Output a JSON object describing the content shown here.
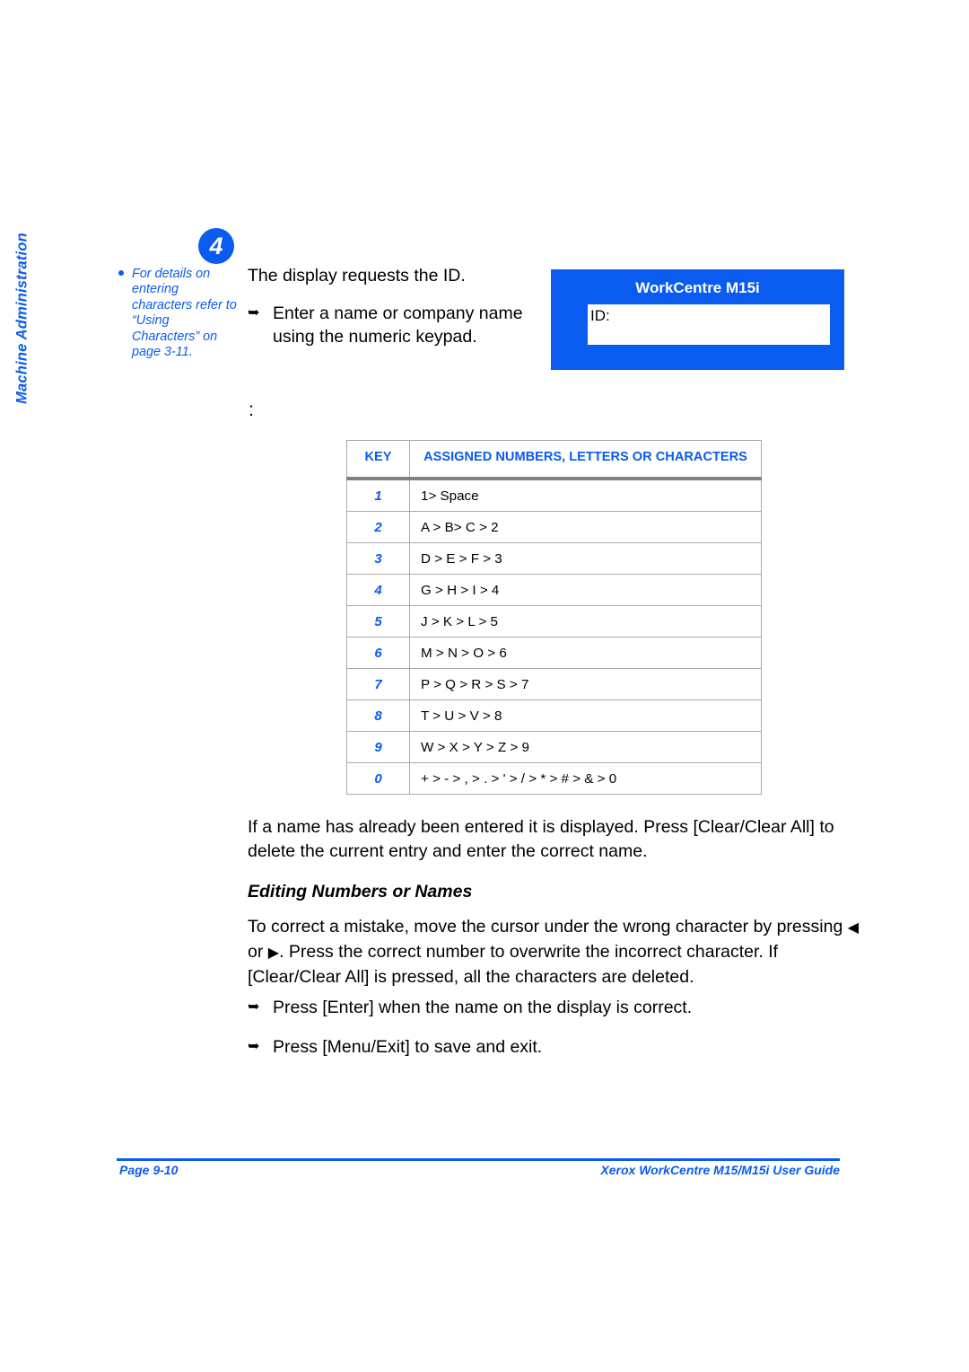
{
  "chapter_tab": {
    "label": "Machine Administration"
  },
  "margin_note": {
    "bullet_icon": "bullet-dot-icon",
    "text": "For details on entering characters refer to “Using Characters” on page 3-11."
  },
  "step": {
    "number": "4",
    "lead": "The display requests the ID.",
    "arrow_icon": "arrow-bullet-icon",
    "items": [
      "Enter a name or company name using the numeric keypad."
    ]
  },
  "colon_artifact": ":",
  "lcd_panel": {
    "title": "WorkCentre M15i",
    "screen_text": "ID:",
    "panel_color": "#0A5BEF",
    "screen_color": "#FFFFFF",
    "title_color": "#FFFFFF"
  },
  "key_table": {
    "headers": [
      "KEY",
      "ASSIGNED NUMBERS, LETTERS OR CHARACTERS"
    ],
    "header_color": "#0A5BEF",
    "key_color": "#0A5BEF",
    "rows": [
      {
        "key": "1",
        "chars": "1> Space"
      },
      {
        "key": "2",
        "chars": "A > B> C > 2"
      },
      {
        "key": "3",
        "chars": "D > E > F > 3"
      },
      {
        "key": "4",
        "chars": "G > H > I > 4"
      },
      {
        "key": "5",
        "chars": "J > K > L > 5"
      },
      {
        "key": "6",
        "chars": "M > N > O > 6"
      },
      {
        "key": "7",
        "chars": "P > Q > R > S > 7"
      },
      {
        "key": "8",
        "chars": "T > U > V > 8"
      },
      {
        "key": "9",
        "chars": "W > X > Y > Z > 9"
      },
      {
        "key": "0",
        "chars": "+ > - > , > . > ' > / > * > # > & > 0"
      }
    ]
  },
  "body": {
    "paragraph_1": "If a name has already been entered it is displayed. Press [Clear/Clear All] to delete the current entry and enter the correct name.",
    "section_heading": "Editing Numbers or Names",
    "paragraph_2_part1": "To correct a mistake, move the cursor under the wrong character by pressing",
    "paragraph_2_left_arrow": "◀",
    "paragraph_2_or": "or",
    "paragraph_2_right_arrow": "▶",
    "paragraph_2_part2": ". Press the correct number to overwrite the incorrect character. If [Clear/Clear All] is pressed, all the characters are deleted.",
    "arrow_icon": "arrow-bullet-icon",
    "bullets": [
      "Press [Enter] when the name on the display is correct.",
      "Press [Menu/Exit] to save and exit."
    ]
  },
  "footer": {
    "page_label": "Page 9-10",
    "guide_title": "Xerox WorkCentre M15/M15i User Guide",
    "rule_color": "#0A5BEF"
  }
}
